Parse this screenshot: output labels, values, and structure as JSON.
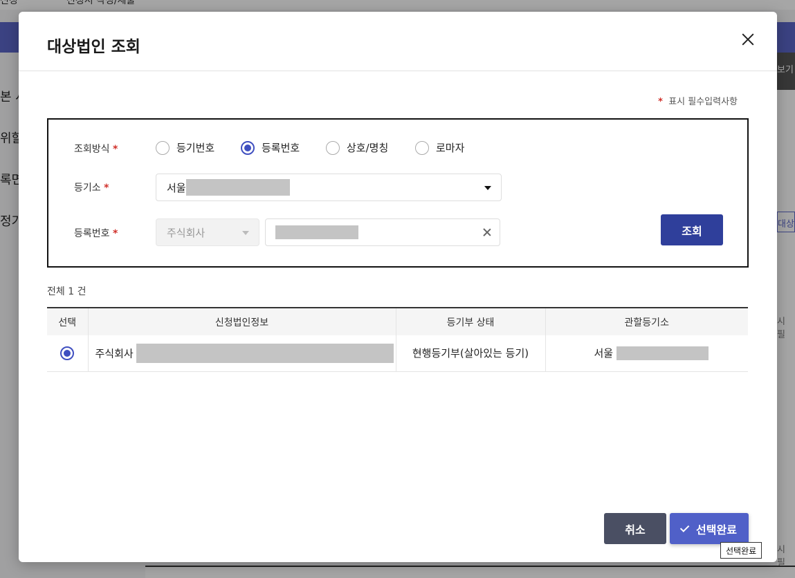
{
  "background": {
    "top_menu_1": "신청",
    "top_menu_2": "신청서 작성/제출",
    "left_items": [
      "본 사",
      "위할",
      "록면",
      "정기"
    ],
    "right_tab": "보기",
    "right_link": "대상법",
    "right_note_1": "시 필",
    "right_note_2": "시 필"
  },
  "modal": {
    "title": "대상법인 조회",
    "required_note": "표시 필수입력사항",
    "star": "*",
    "search": {
      "method_label": "조회방식",
      "method_options": [
        {
          "label": "등기번호",
          "checked": false
        },
        {
          "label": "등록번호",
          "checked": true
        },
        {
          "label": "상호/명칭",
          "checked": false
        },
        {
          "label": "로마자",
          "checked": false
        }
      ],
      "registry_label": "등기소",
      "registry_value": "서울",
      "regno_label": "등록번호",
      "corp_type_value": "주식회사",
      "search_button": "조회"
    },
    "total_text": "전체 1 건",
    "table": {
      "headers": [
        "선택",
        "신청법인정보",
        "등기부 상태",
        "관할등기소"
      ],
      "rows": [
        {
          "selected": true,
          "corp": "주식회사",
          "status": "현행등기부(살아있는 등기)",
          "office": "서울"
        }
      ]
    },
    "cancel_button": "취소",
    "confirm_button": "선택완료",
    "tooltip": "선택완료"
  },
  "colors": {
    "primary": "#2f3f9b",
    "confirm": "#5060c8",
    "cancel": "#4a4f63",
    "required": "#d0302a"
  }
}
